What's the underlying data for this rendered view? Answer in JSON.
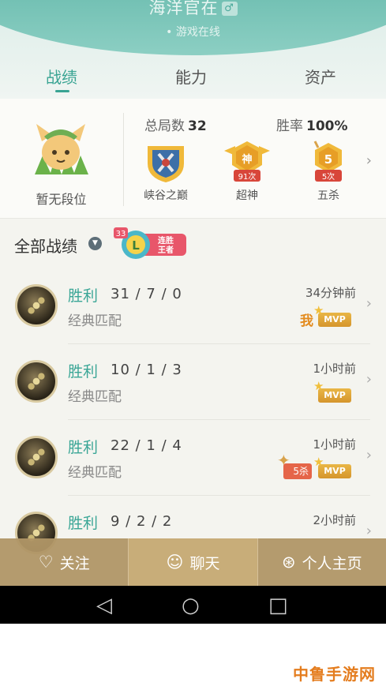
{
  "header": {
    "player_name": "海洋官在",
    "gender_icon": "male-icon",
    "status": "• 游戏在线"
  },
  "tabs": [
    {
      "label": "战绩",
      "active": true
    },
    {
      "label": "能力",
      "active": false
    },
    {
      "label": "资产",
      "active": false
    }
  ],
  "stats": {
    "rank_label": "暂无段位",
    "total_games_label": "总局数",
    "total_games_value": "32",
    "win_rate_label": "胜率",
    "win_rate_value": "100%",
    "badges": [
      {
        "icon": "valley-peak-badge-icon",
        "count": "",
        "label": "峡谷之巅"
      },
      {
        "icon": "godlike-badge-icon",
        "glyph": "神",
        "count": "91次",
        "label": "超神"
      },
      {
        "icon": "penta-kill-badge-icon",
        "glyph": "5",
        "count": "5次",
        "label": "五杀"
      }
    ]
  },
  "records": {
    "title": "全部战绩",
    "streak_badge": {
      "count": "33",
      "letter": "L",
      "text_line1": "连胜",
      "text_line2": "王者"
    },
    "items": [
      {
        "result": "胜利",
        "kda": "31 / 7 / 0",
        "mode": "经典匹配",
        "time": "34分钟前",
        "me_mark": "我",
        "penta": "",
        "mvp": "MVP"
      },
      {
        "result": "胜利",
        "kda": "10 / 1 / 3",
        "mode": "经典匹配",
        "time": "1小时前",
        "me_mark": "",
        "penta": "",
        "mvp": "MVP"
      },
      {
        "result": "胜利",
        "kda": "22 / 1 / 4",
        "mode": "经典匹配",
        "time": "1小时前",
        "me_mark": "",
        "penta": "5杀",
        "mvp": "MVP"
      },
      {
        "result": "胜利",
        "kda": "9 / 2 / 2",
        "mode": "",
        "time": "2小时前",
        "me_mark": "",
        "penta": "",
        "mvp": ""
      }
    ]
  },
  "actions": {
    "follow": "关注",
    "chat": "聊天",
    "profile": "个人主页"
  },
  "nav": {
    "back": "◁",
    "home": "○",
    "recents": "□"
  },
  "watermark": "中鲁手游网",
  "colors": {
    "accent": "#39a493",
    "action_bar": "#b09666",
    "mvp": "#e0a83a"
  }
}
